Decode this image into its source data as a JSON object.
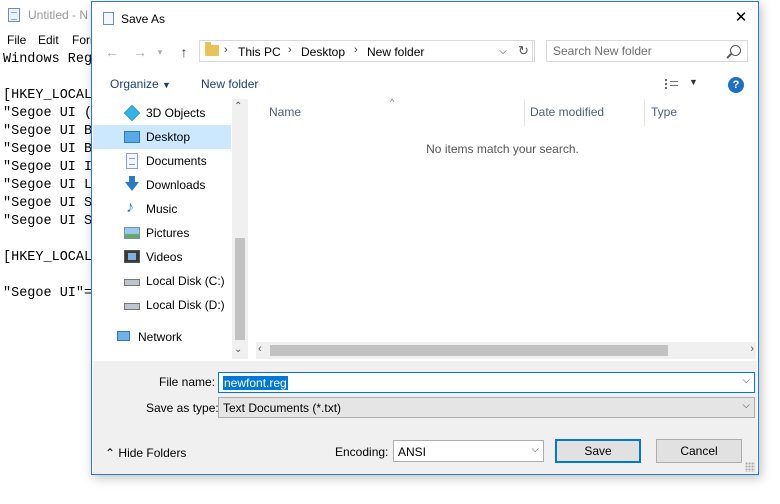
{
  "notepad": {
    "title": "Untitled - N",
    "menu": [
      "File",
      "Edit",
      "Forr"
    ],
    "lines": [
      "Windows Reg",
      "",
      "[HKEY_LOCAL",
      "\"Segoe UI (",
      "\"Segoe UI B",
      "\"Segoe UI B",
      "\"Segoe UI I",
      "\"Segoe UI L",
      "\"Segoe UI S",
      "\"Segoe UI S",
      "",
      "[HKEY_LOCAL",
      "",
      "\"Segoe UI\"="
    ]
  },
  "dialog": {
    "title": "Save As",
    "close_icon": "close-icon",
    "address": {
      "crumbs": [
        "This PC",
        "Desktop",
        "New folder"
      ]
    },
    "search": {
      "placeholder": "Search New folder"
    },
    "toolbar": {
      "organize": "Organize",
      "new_folder": "New folder",
      "help": "?"
    },
    "nav": {
      "items": [
        {
          "label": "3D Objects",
          "icon": "3d-objects-icon"
        },
        {
          "label": "Desktop",
          "icon": "desktop-icon",
          "selected": true
        },
        {
          "label": "Documents",
          "icon": "documents-icon"
        },
        {
          "label": "Downloads",
          "icon": "downloads-icon"
        },
        {
          "label": "Music",
          "icon": "music-icon"
        },
        {
          "label": "Pictures",
          "icon": "pictures-icon"
        },
        {
          "label": "Videos",
          "icon": "videos-icon"
        },
        {
          "label": "Local Disk (C:)",
          "icon": "local-disk-icon"
        },
        {
          "label": "Local Disk (D:)",
          "icon": "local-disk-icon"
        },
        {
          "label": "Network",
          "icon": "network-icon"
        }
      ]
    },
    "columns": [
      "Name",
      "Date modified",
      "Type"
    ],
    "empty_message": "No items match your search.",
    "bottom": {
      "file_name_label": "File name:",
      "file_name_value": "newfont.reg",
      "save_as_type_label": "Save as type:",
      "save_as_type_value": "Text Documents (*.txt)",
      "hide_folders": "Hide Folders",
      "encoding_label": "Encoding:",
      "encoding_value": "ANSI",
      "save": "Save",
      "cancel": "Cancel"
    }
  },
  "colors": {
    "accent": "#0078d7",
    "selection_bg": "#cce8ff",
    "link_blue": "#1a3f6b"
  }
}
